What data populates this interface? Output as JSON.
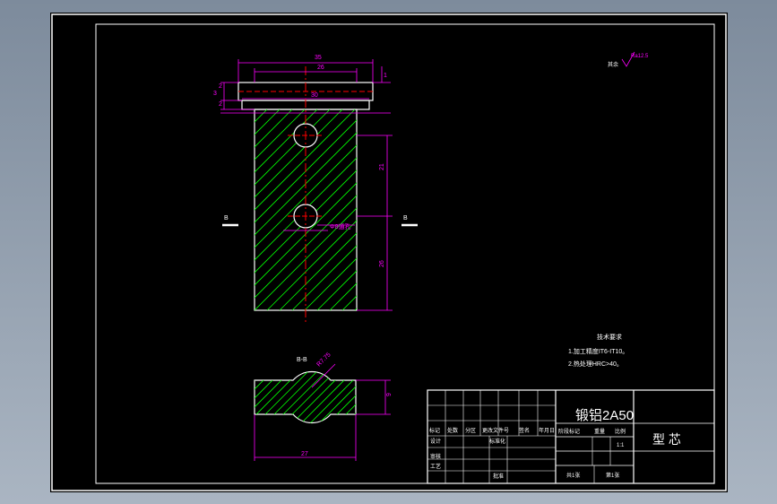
{
  "colors": {
    "background": "#000000",
    "frame": "#ffffff",
    "dimension": "#ff00ff",
    "hatch": "#00ff00",
    "centerline": "#ff0000",
    "viewport_bg": "#8e9aa9"
  },
  "roughness": {
    "symbol": "Ra12.5",
    "note": "其余"
  },
  "dims": {
    "d35": "35",
    "d26": "26",
    "d30": "30",
    "d1": "1",
    "d3": "3",
    "d2a": "2",
    "d2b": "2",
    "d21": "21",
    "d26b": "26",
    "d8": "Φ8通孔",
    "d9": "9",
    "d27": "27",
    "r": "R7.75"
  },
  "section_marks": {
    "left": "B",
    "right": "B",
    "section_title": "B-B"
  },
  "tech": {
    "title": "技术要求",
    "line1": "1.加工精度IT6-IT10。",
    "line2": "2.热处理HRC>40。"
  },
  "title_block": {
    "material": "锻铝2A50",
    "part_name": "型  芯",
    "header_row": [
      "标记",
      "处数",
      "分区",
      "更改文件号",
      "签名",
      "年月日"
    ],
    "design": "设计",
    "standard": "标准化",
    "check": "审核",
    "process": "工艺",
    "approve": "批准",
    "stage_label": "阶段标记",
    "weight_label": "重量",
    "scale_label": "比例",
    "scale_value": "1:1",
    "sheets": "共1张",
    "sheet_no": "第1张"
  }
}
